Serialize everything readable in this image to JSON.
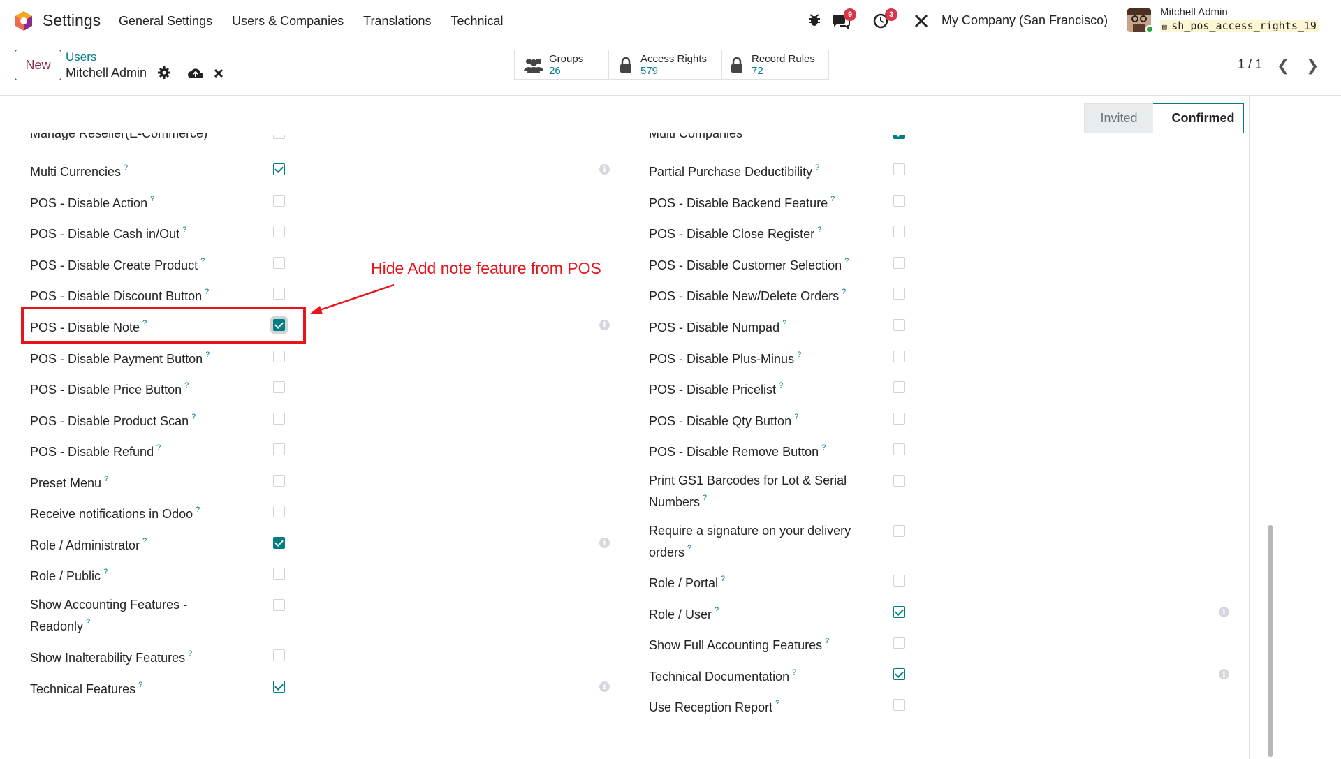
{
  "app": {
    "name": "Settings"
  },
  "topmenu": [
    "General Settings",
    "Users & Companies",
    "Translations",
    "Technical"
  ],
  "systray": {
    "messages_count": "9",
    "activities_count": "3",
    "company": "My Company (San Francisco)",
    "user_name": "Mitchell Admin",
    "database": "sh_pos_access_rights_19"
  },
  "control": {
    "new_label": "New",
    "breadcrumb_parent": "Users",
    "breadcrumb_current": "Mitchell Admin",
    "stats": [
      {
        "label": "Groups",
        "value": "26"
      },
      {
        "label": "Access Rights",
        "value": "579"
      },
      {
        "label": "Record Rules",
        "value": "72"
      }
    ],
    "pager": "1 / 1"
  },
  "status": {
    "states": [
      "Invited",
      "Confirmed"
    ],
    "current": "Confirmed"
  },
  "left_column": [
    {
      "label": "Manage Reseller(E-Commerce)",
      "state": "unchecked",
      "cut": true
    },
    {
      "label": "Multi Currencies",
      "state": "outline",
      "info": true
    },
    {
      "label": "POS - Disable Action",
      "state": "unchecked"
    },
    {
      "label": "POS - Disable Cash in/Out",
      "state": "unchecked"
    },
    {
      "label": "POS - Disable Create Product",
      "state": "unchecked"
    },
    {
      "label": "POS - Disable Discount Button",
      "state": "unchecked"
    },
    {
      "label": "POS - Disable Note",
      "state": "fill-focus",
      "info": true
    },
    {
      "label": "POS - Disable Payment Button",
      "state": "unchecked"
    },
    {
      "label": "POS - Disable Price Button",
      "state": "unchecked"
    },
    {
      "label": "POS - Disable Product Scan",
      "state": "unchecked"
    },
    {
      "label": "POS - Disable Refund",
      "state": "unchecked"
    },
    {
      "label": "Preset Menu",
      "state": "unchecked"
    },
    {
      "label": "Receive notifications in Odoo",
      "state": "unchecked"
    },
    {
      "label": "Role / Administrator",
      "state": "fill",
      "info": true
    },
    {
      "label": "Role / Public",
      "state": "unchecked"
    },
    {
      "label": "Show Accounting Features -",
      "label2": "Readonly",
      "state": "unchecked"
    },
    {
      "label": "Show Inalterability Features",
      "state": "unchecked"
    },
    {
      "label": "Technical Features",
      "state": "outline",
      "info": true
    }
  ],
  "right_column": [
    {
      "label": "Multi Companies",
      "state": "fill",
      "cut": true
    },
    {
      "label": "Partial Purchase Deductibility",
      "state": "unchecked"
    },
    {
      "label": "POS - Disable Backend Feature",
      "state": "unchecked"
    },
    {
      "label": "POS - Disable Close Register",
      "state": "unchecked"
    },
    {
      "label": "POS - Disable Customer Selection",
      "state": "unchecked"
    },
    {
      "label": "POS - Disable New/Delete Orders",
      "state": "unchecked"
    },
    {
      "label": "POS - Disable Numpad",
      "state": "unchecked"
    },
    {
      "label": "POS - Disable Plus-Minus",
      "state": "unchecked"
    },
    {
      "label": "POS - Disable Pricelist",
      "state": "unchecked"
    },
    {
      "label": "POS - Disable Qty Button",
      "state": "unchecked"
    },
    {
      "label": "POS - Disable Remove Button",
      "state": "unchecked"
    },
    {
      "label": "Print GS1 Barcodes for Lot & Serial",
      "label2": "Numbers",
      "state": "unchecked"
    },
    {
      "label": "Require a signature on your delivery",
      "label2": "orders",
      "state": "unchecked"
    },
    {
      "label": "Role / Portal",
      "state": "unchecked"
    },
    {
      "label": "Role / User",
      "state": "outline",
      "info": true
    },
    {
      "label": "Show Full Accounting Features",
      "state": "unchecked"
    },
    {
      "label": "Technical Documentation",
      "state": "outline",
      "info": true
    },
    {
      "label": "Use Reception Report",
      "state": "unchecked"
    }
  ],
  "annotation": {
    "text": "Hide Add note feature from POS"
  },
  "colors": {
    "accent": "#017e84",
    "brand": "#8b2d4a",
    "annotation": "#e8141c"
  }
}
